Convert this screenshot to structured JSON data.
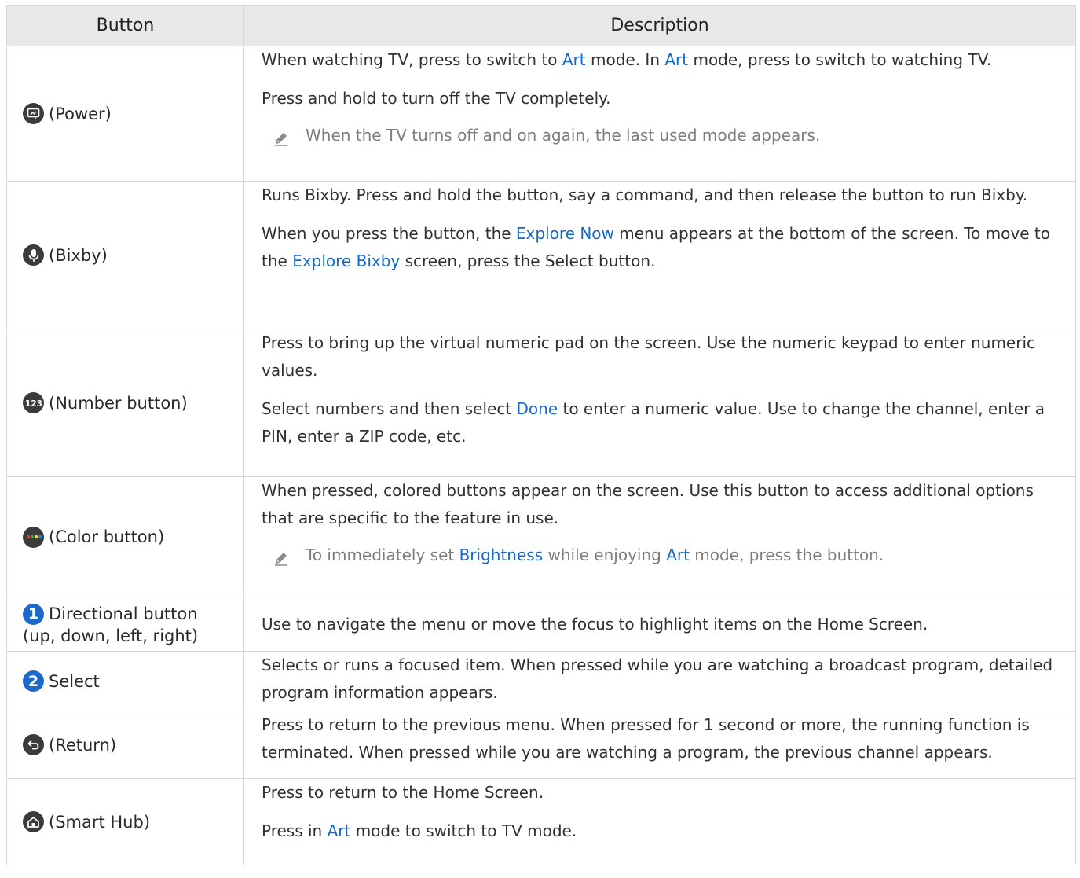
{
  "headers": {
    "button": "Button",
    "description": "Description"
  },
  "rows": [
    {
      "button": "(Power)",
      "p1": [
        "When watching TV, press to switch to ",
        "Art",
        " mode. In ",
        "Art",
        " mode, press to switch to watching TV."
      ],
      "p2": "Press and hold to turn off the TV completely.",
      "note": "When the TV turns off and on again, the last used mode appears."
    },
    {
      "button": "(Bixby)",
      "p1": "Runs Bixby. Press and hold the button, say a command, and then release the button to run Bixby.",
      "p2": [
        "When you press the button, the ",
        "Explore Now",
        " menu appears at the bottom of the screen. To move to the ",
        "Explore Bixby",
        " screen, press the Select button."
      ]
    },
    {
      "button": "(Number button)",
      "p1": "Press to bring up the virtual numeric pad on the screen. Use the numeric keypad to enter numeric values.",
      "p2": [
        "Select numbers and then select ",
        "Done",
        " to enter a numeric value. Use to change the channel, enter a PIN, enter a ZIP code, etc."
      ]
    },
    {
      "button": "(Color button)",
      "p1": "When pressed, colored buttons appear on the screen. Use this button to access additional options that are specific to the feature in use.",
      "note": [
        "To immediately set ",
        "Brightness",
        " while enjoying ",
        "Art",
        " mode, press the button."
      ]
    },
    {
      "badge": "1",
      "button": "Directional button",
      "button_sub": "(up, down, left, right)",
      "p1": "Use to navigate the menu or move the focus to highlight items on the Home Screen."
    },
    {
      "badge": "2",
      "button": "Select",
      "p1": "Selects or runs a focused item. When pressed while you are watching a broadcast program, detailed program information appears."
    },
    {
      "button": "(Return)",
      "p1": "Press to return to the previous menu. When pressed for 1 second or more, the running function is terminated. When pressed while you are watching a program, the previous channel appears."
    },
    {
      "button": "(Smart Hub)",
      "p1": "Press to return to the Home Screen.",
      "p2": [
        "Press in ",
        "Art",
        " mode to switch to TV mode."
      ]
    }
  ],
  "icons": {
    "power": "art-mode-power-icon",
    "bixby": "microphone-icon",
    "number": "number-123-icon",
    "color": "color-dots-icon",
    "return": "return-arrow-icon",
    "home": "home-icon",
    "note": "pencil-note-icon"
  },
  "colors": {
    "highlight": "#1567c9",
    "badge": "#1b6ac9",
    "note_text": "#7d7d7d",
    "header_bg": "#e8e8e8"
  }
}
